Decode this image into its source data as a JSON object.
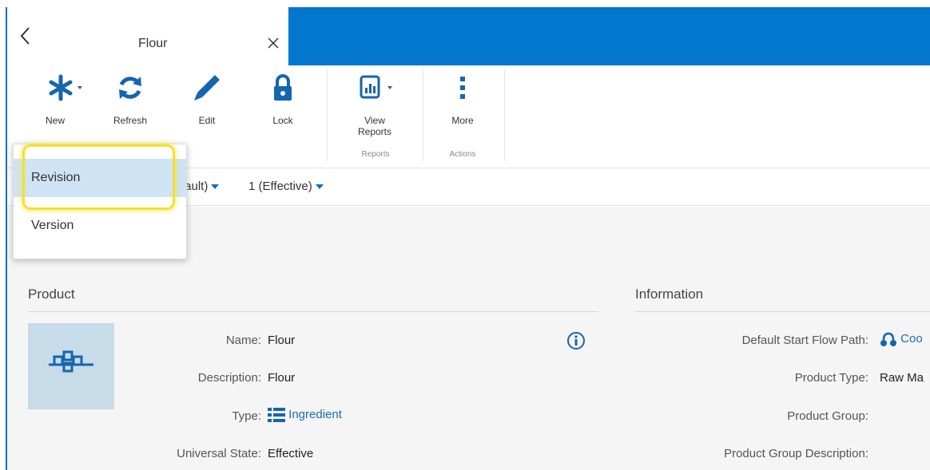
{
  "tab": {
    "title": "Flour"
  },
  "ribbon": {
    "new_label": "New",
    "refresh_label": "Refresh",
    "edit_label": "Edit",
    "lock_label": "Lock",
    "view_reports_label": "View\nReports",
    "more_label": "More",
    "group_reports": "Reports",
    "group_actions": "Actions"
  },
  "crumbs": {
    "version_selector": "fault)",
    "revision_selector": "1 (Effective)"
  },
  "dropdown": {
    "items": [
      "Revision",
      "Version"
    ],
    "selected": "Revision"
  },
  "product": {
    "section_title": "Product",
    "fields": [
      {
        "label": "Name:",
        "value": "Flour"
      },
      {
        "label": "Description:",
        "value": "Flour"
      },
      {
        "label": "Type:",
        "value": "Ingredient"
      },
      {
        "label": "Universal State:",
        "value": "Effective"
      }
    ]
  },
  "information": {
    "section_title": "Information",
    "fields": [
      {
        "label": "Default Start Flow Path:",
        "value": "Coo"
      },
      {
        "label": "Product Type:",
        "value": "Raw Ma"
      },
      {
        "label": "Product Group:",
        "value": ""
      },
      {
        "label": "Product Group Description:",
        "value": ""
      }
    ]
  },
  "colors": {
    "header": "#0277cd",
    "accent": "#1a6cb8",
    "highlight": "#f5e12a"
  }
}
